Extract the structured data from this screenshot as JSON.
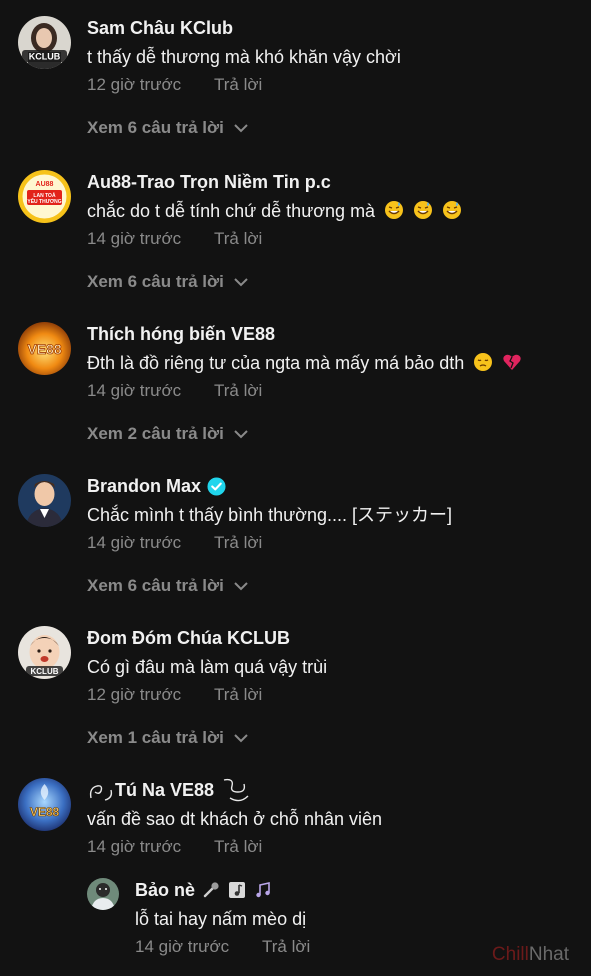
{
  "comments": [
    {
      "author": "Sam Châu KClub",
      "text": "t thấy dễ thương mà khó khăn vậy chời",
      "time": "12 giờ trước",
      "reply_label": "Trả lời",
      "view_replies": "Xem 6 câu trả lời",
      "avatar_label": "KCLUB"
    },
    {
      "author": "Au88-Trao Trọn Niềm Tin p.c",
      "text": "chắc do t dễ tính chứ dễ thương mà",
      "time": "14 giờ trước",
      "reply_label": "Trả lời",
      "view_replies": "Xem 6 câu trả lời",
      "avatar_label": "AU88 LAN TOẢ YÊU THƯƠNG"
    },
    {
      "author": "Thích hóng biến VE88",
      "text": "Đth là đồ riêng tư của ngta mà mấy má bảo dth",
      "time": "14 giờ trước",
      "reply_label": "Trả lời",
      "view_replies": "Xem 2 câu trả lời",
      "avatar_label": "VE88"
    },
    {
      "author": "Brandon Max",
      "text": "Chắc mình t thấy bình thường.... [ステッカー]",
      "time": "14 giờ trước",
      "reply_label": "Trả lời",
      "view_replies": "Xem 6 câu trả lời"
    },
    {
      "author": "Đom Đóm Chúa KCLUB",
      "text": "Có gì đâu mà làm quá vậy trùi",
      "time": "12 giờ trước",
      "reply_label": "Trả lời",
      "view_replies": "Xem 1 câu trả lời",
      "avatar_label": "KCLUB"
    },
    {
      "author": "Tú Na VE88",
      "text": "vấn đề sao dt khách ở chỗ nhân viên",
      "time": "14 giờ trước",
      "reply_label": "Trả lời",
      "avatar_label": "VE88"
    }
  ],
  "reply": {
    "author": "Bảo nè",
    "text": "lỗ tai hay nấm mèo dị",
    "time": "14 giờ trước",
    "reply_label": "Trả lời"
  },
  "watermark": {
    "part1": "Chill",
    "part2": "Nhat"
  },
  "colors": {
    "background": "#121212",
    "primary_text": "#f1f1f1",
    "secondary_text": "#8a8a8a",
    "verified": "#20d5ec"
  }
}
